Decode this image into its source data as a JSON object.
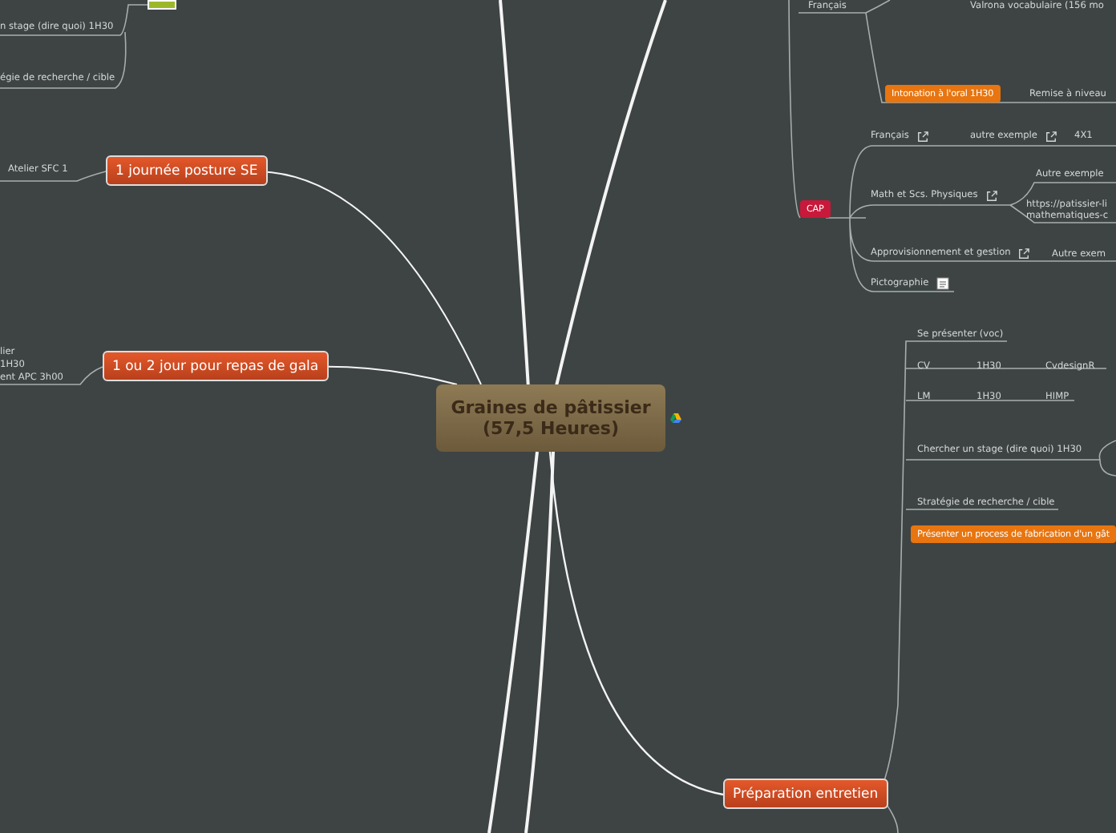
{
  "central": {
    "title": "Graines de pâtissier",
    "subtitle": "(57,5 Heures)"
  },
  "topics": [
    {
      "label": "1 journée posture SE"
    },
    {
      "label": "1 ou 2 jour pour repas de gala"
    },
    {
      "label": "Préparation entretien"
    }
  ],
  "labels": [
    {
      "text": "n stage (dire quoi) 1H30",
      "link": false
    },
    {
      "text": "égie de recherche / cible",
      "link": false
    },
    {
      "text": "Atelier SFC 1",
      "link": false
    },
    {
      "text": "lier",
      "link": false
    },
    {
      "text": "1H30",
      "link": false
    },
    {
      "text": "ent APC 3h00",
      "link": false
    },
    {
      "text": "Français",
      "link": false
    },
    {
      "text": "Valrona vocabulaire  (156 mo",
      "link": false
    },
    {
      "text": "Remise à niveau",
      "link": false
    },
    {
      "text": "Français",
      "link": true
    },
    {
      "text": "autre exemple",
      "link": true
    },
    {
      "text": "4X1",
      "link": false
    },
    {
      "text": "Autre exemple",
      "link": false
    },
    {
      "text": "Math et Scs. Physiques",
      "link": true
    },
    {
      "text": "https://patissier-li",
      "link": false
    },
    {
      "text": "mathematiques-c",
      "link": false
    },
    {
      "text": "Approvisionnement et gestion",
      "link": true
    },
    {
      "text": "Autre exem",
      "link": false
    },
    {
      "text": "Pictographie",
      "link": false
    },
    {
      "text": "Se présenter (voc)",
      "link": false
    },
    {
      "text": "CV",
      "link": false
    },
    {
      "text": "1H30",
      "link": false
    },
    {
      "text": "CvdesignR",
      "link": false
    },
    {
      "text": "LM",
      "link": false
    },
    {
      "text": "1H30",
      "link": false
    },
    {
      "text": "HIMP",
      "link": false
    },
    {
      "text": "Chercher un stage (dire quoi) 1H30",
      "link": false
    },
    {
      "text": "Stratégie de recherche / cible",
      "link": false
    }
  ],
  "badges": [
    {
      "text": "Intonation à l'oral 1H30",
      "color": "#e8750f"
    },
    {
      "text": "CAP",
      "color": "#c8193a"
    },
    {
      "text": "Présenter un process de fabrication d'un gât",
      "color": "#e8750f"
    }
  ]
}
